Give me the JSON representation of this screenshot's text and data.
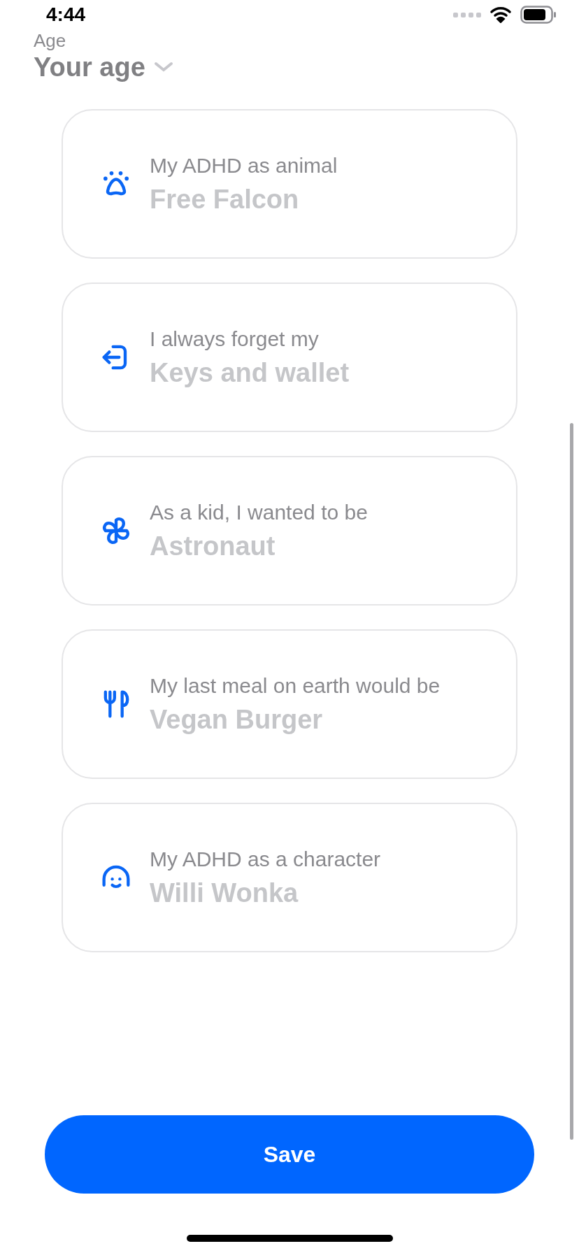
{
  "status_bar": {
    "time": "4:44"
  },
  "header": {
    "label": "Age",
    "title": "Your age"
  },
  "cards": [
    {
      "label": "My ADHD as animal",
      "value": "Free Falcon"
    },
    {
      "label": "I always forget my",
      "value": "Keys and wallet"
    },
    {
      "label": "As a kid, I wanted to be",
      "value": "Astronaut"
    },
    {
      "label": "My last meal on earth would be",
      "value": "Vegan Burger"
    },
    {
      "label": "My ADHD as a character",
      "value": "Willi Wonka"
    }
  ],
  "save_button": {
    "label": "Save"
  }
}
